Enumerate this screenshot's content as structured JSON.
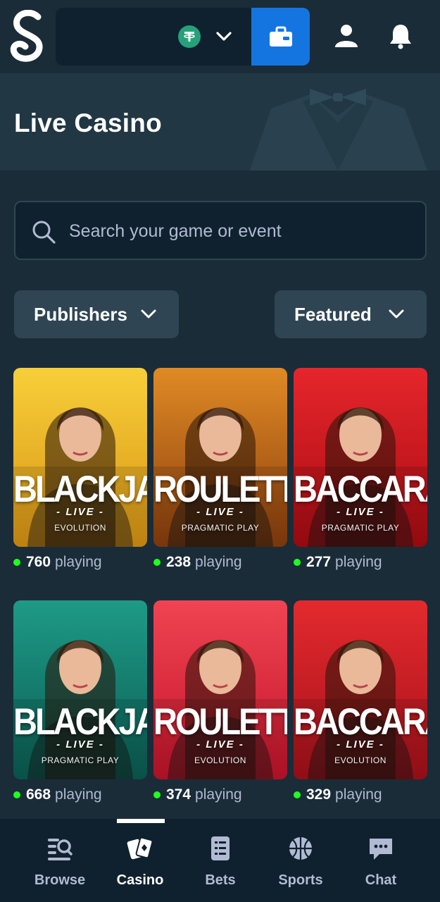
{
  "header": {
    "logo_letter": "S",
    "currency_icon": "tether-usdt-icon",
    "wallet_button_icon": "wallet-icon",
    "profile_icon": "user-icon",
    "notifications_icon": "bell-icon"
  },
  "hero": {
    "title": "Live Casino"
  },
  "search": {
    "placeholder": "Search your game or event"
  },
  "filters": {
    "publishers_label": "Publishers",
    "sort_label": "Featured"
  },
  "games": [
    {
      "name": "BLACKJACK",
      "tag": "- LIVE -",
      "provider": "EVOLUTION",
      "count": "760",
      "playing_label": "playing",
      "theme": [
        "#f7cf3a",
        "#d99414"
      ]
    },
    {
      "name": "ROULETTE",
      "tag": "- LIVE -",
      "provider": "PRAGMATIC PLAY",
      "count": "238",
      "playing_label": "playing",
      "theme": [
        "#e08a25",
        "#8a3e0d"
      ]
    },
    {
      "name": "BACCARAT",
      "tag": "- LIVE -",
      "provider": "PRAGMATIC PLAY",
      "count": "277",
      "playing_label": "playing",
      "theme": [
        "#e5262c",
        "#a80c12"
      ]
    },
    {
      "name": "BLACKJACK",
      "tag": "- LIVE -",
      "provider": "PRAGMATIC PLAY",
      "count": "668",
      "playing_label": "playing",
      "theme": [
        "#1e9a86",
        "#0b5d54"
      ]
    },
    {
      "name": "ROULETTE",
      "tag": "- LIVE -",
      "provider": "EVOLUTION",
      "count": "374",
      "playing_label": "playing",
      "theme": [
        "#f04452",
        "#c3142a"
      ]
    },
    {
      "name": "BACCARAT",
      "tag": "- LIVE -",
      "provider": "EVOLUTION",
      "count": "329",
      "playing_label": "playing",
      "theme": [
        "#e32a2e",
        "#a5111a"
      ]
    }
  ],
  "bottom_nav": [
    {
      "label": "Browse",
      "icon": "browse-icon"
    },
    {
      "label": "Casino",
      "icon": "casino-cards-icon"
    },
    {
      "label": "Bets",
      "icon": "bets-slip-icon"
    },
    {
      "label": "Sports",
      "icon": "basketball-icon"
    },
    {
      "label": "Chat",
      "icon": "chat-icon"
    }
  ]
}
